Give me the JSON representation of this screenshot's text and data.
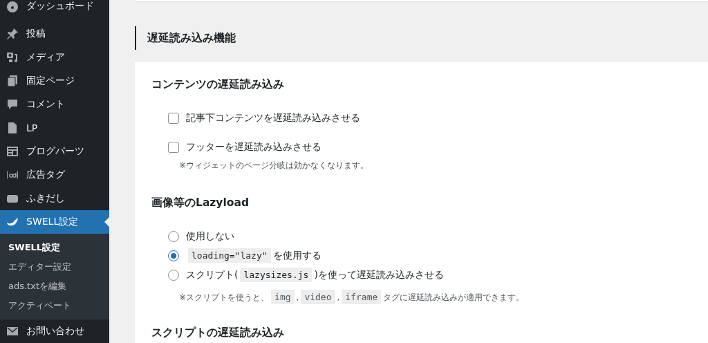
{
  "sidebar": {
    "items": [
      {
        "label": "ダッシュボード",
        "selected": false
      },
      {
        "label": "投稿",
        "selected": false
      },
      {
        "label": "メディア",
        "selected": false
      },
      {
        "label": "固定ページ",
        "selected": false
      },
      {
        "label": "コメント",
        "selected": false
      },
      {
        "label": "LP",
        "selected": false
      },
      {
        "label": "ブログパーツ",
        "selected": false
      },
      {
        "label": "広告タグ",
        "selected": false
      },
      {
        "label": "ふきだし",
        "selected": false
      },
      {
        "label": "SWELL設定",
        "selected": true,
        "children": [
          {
            "label": "SWELL設定",
            "selected": true
          },
          {
            "label": "エディター設定",
            "selected": false
          },
          {
            "label": "ads.txtを編集",
            "selected": false
          },
          {
            "label": "アクティベート",
            "selected": false
          }
        ]
      },
      {
        "label": "お問い合わせ",
        "selected": false
      }
    ]
  },
  "section_title": "遅延読み込み機能",
  "groups": [
    {
      "title": "コンテンツの遅延読み込み",
      "options": [
        {
          "kind": "checkbox",
          "checked": false,
          "parts": [
            {
              "kind": "text",
              "text": "記事下コンテンツを遅延読み込みさせる"
            }
          ]
        },
        {
          "kind": "checkbox",
          "checked": false,
          "parts": [
            {
              "kind": "text",
              "text": "フッターを遅延読み込みさせる"
            }
          ]
        }
      ],
      "note": [
        {
          "kind": "text",
          "text": "※ウィジェットのページ分岐は効かなくなります。"
        }
      ]
    },
    {
      "title": "画像等のLazyload",
      "options": [
        {
          "kind": "radio",
          "selected": false,
          "parts": [
            {
              "kind": "text",
              "text": "使用しない"
            }
          ]
        },
        {
          "kind": "radio",
          "selected": true,
          "parts": [
            {
              "kind": "code",
              "text": "loading=\"lazy\""
            },
            {
              "kind": "text",
              "text": "を使用する"
            }
          ]
        },
        {
          "kind": "radio",
          "selected": false,
          "parts": [
            {
              "kind": "text",
              "text": "スクリプト("
            },
            {
              "kind": "code",
              "text": "lazysizes.js"
            },
            {
              "kind": "text",
              "text": ")を使って遅延読み込みさせる"
            }
          ]
        }
      ],
      "note": [
        {
          "kind": "text",
          "text": "※スクリプトを使うと、"
        },
        {
          "kind": "code",
          "text": "img"
        },
        {
          "kind": "text",
          "text": ","
        },
        {
          "kind": "code",
          "text": "video"
        },
        {
          "kind": "text",
          "text": ","
        },
        {
          "kind": "code",
          "text": "iframe"
        },
        {
          "kind": "text",
          "text": "タグに遅延読み込みが適用できます。"
        }
      ]
    },
    {
      "title": "スクリプトの遅延読み込み"
    }
  ]
}
